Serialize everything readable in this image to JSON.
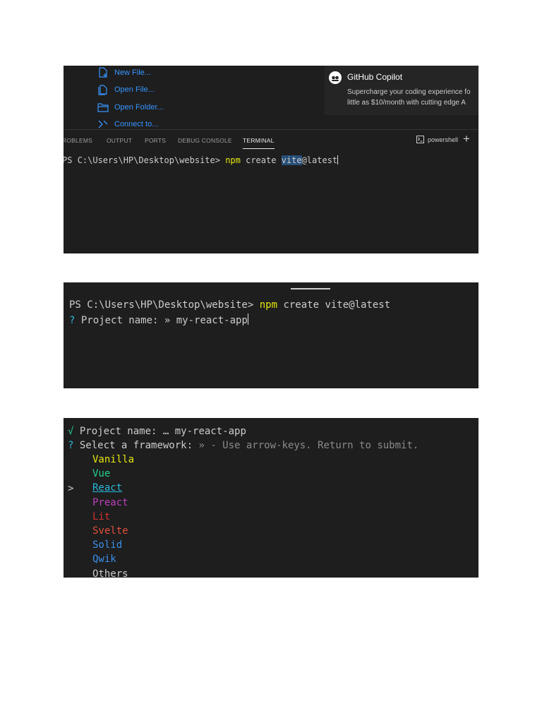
{
  "shot1": {
    "start_links": [
      {
        "label": "New File...",
        "icon": "new-file-icon"
      },
      {
        "label": "Open File...",
        "icon": "open-file-icon"
      },
      {
        "label": "Open Folder...",
        "icon": "open-folder-icon"
      },
      {
        "label": "Connect to...",
        "icon": "connect-icon"
      }
    ],
    "copilot": {
      "title": "GitHub Copilot",
      "desc_line1": "Supercharge your coding experience fo",
      "desc_line2": "little as $10/month with cutting edge A"
    },
    "panel_tabs": [
      "ROBLEMS",
      "OUTPUT",
      "PORTS",
      "DEBUG CONSOLE",
      "TERMINAL"
    ],
    "active_tab": "TERMINAL",
    "shell_label": "powershell",
    "prompt": "PS C:\\Users\\HP\\Desktop\\website> ",
    "cmd_npm": "npm",
    "cmd_create": " create ",
    "cmd_vite": "vite",
    "cmd_rest": "@latest"
  },
  "shot2": {
    "prompt": "PS C:\\Users\\HP\\Desktop\\website> ",
    "cmd_npm": "npm",
    "cmd_rest": " create vite@latest",
    "q_mark": "?",
    "question": " Project name: » ",
    "answer": "my-react-app"
  },
  "shot3": {
    "check": "√",
    "done_label": " Project name: … ",
    "done_value": "my-react-app",
    "q_mark": "?",
    "question": " Select a framework: ",
    "hint": "» - Use arrow-keys. Return to submit.",
    "pointer": ">",
    "options": [
      {
        "label": "Vanilla",
        "color": "#e5e510"
      },
      {
        "label": "Vue",
        "color": "#23d18b"
      },
      {
        "label": "React",
        "color": "#29b8db"
      },
      {
        "label": "Preact",
        "color": "#bc3fbc"
      },
      {
        "label": "Lit",
        "color": "#cd3131"
      },
      {
        "label": "Svelte",
        "color": "#e0503c"
      },
      {
        "label": "Solid",
        "color": "#3b8eea"
      },
      {
        "label": "Qwik",
        "color": "#3b8eea"
      },
      {
        "label": "Others",
        "color": "#cccccc"
      }
    ],
    "selected": "React"
  }
}
